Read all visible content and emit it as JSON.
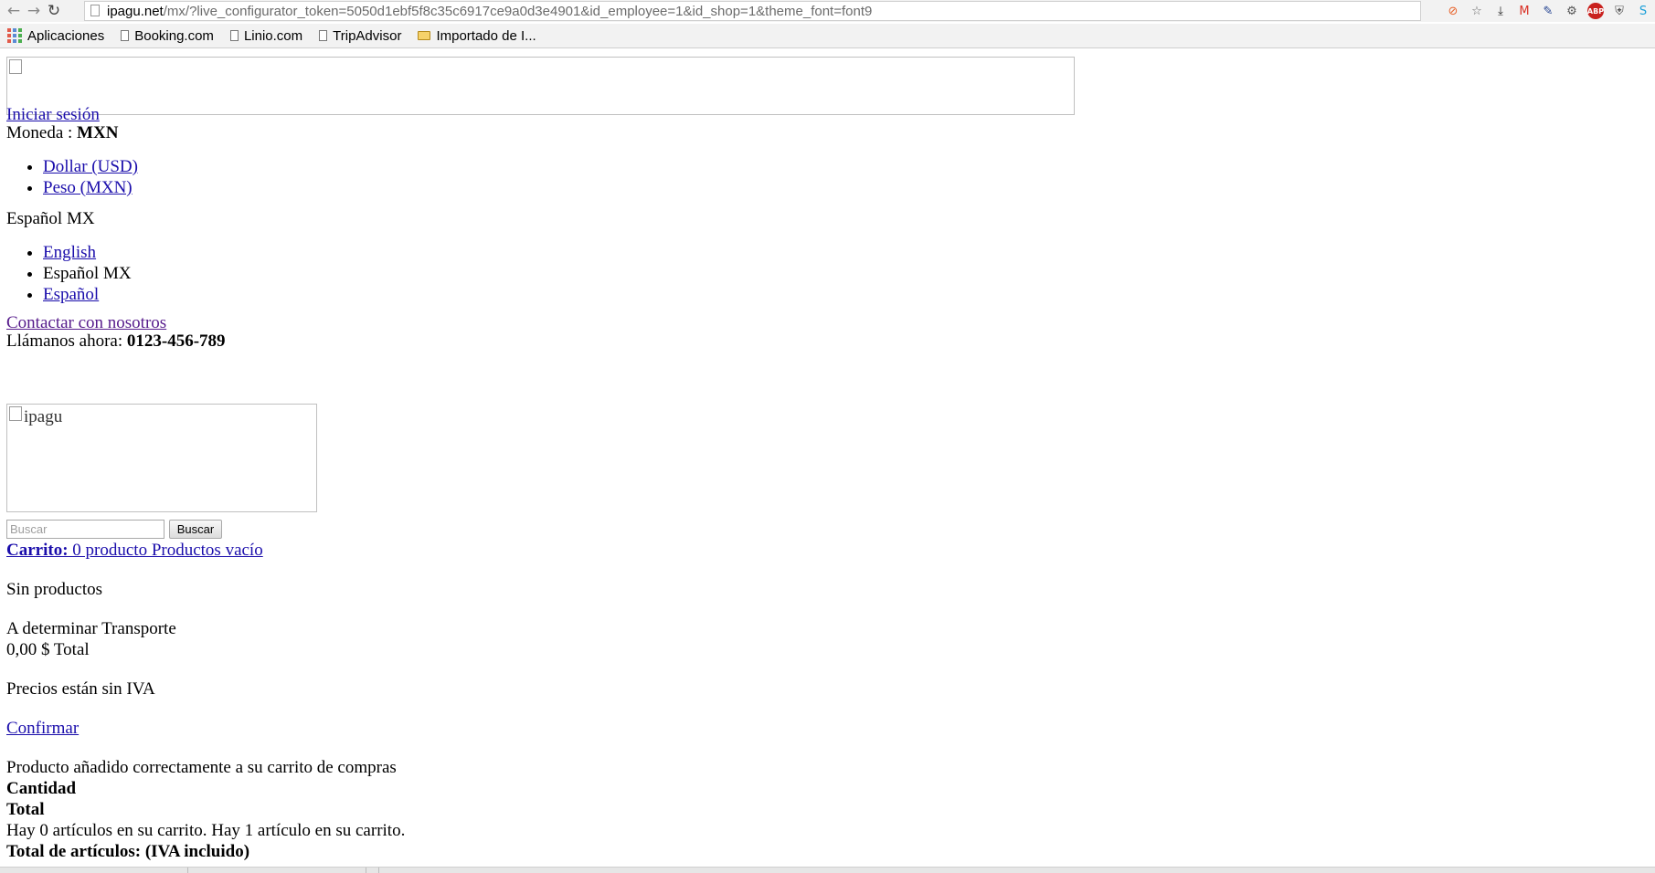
{
  "browser": {
    "nav": {
      "back": "←",
      "forward": "→",
      "reload": "↻"
    },
    "url_host": "ipagu.net",
    "url_rest": "/mx/?live_configurator_token=5050d1ebf5f8c35c6917ce9a0d3e4901&id_employee=1&id_shop=1&theme_font=font9",
    "extensions": [
      {
        "icon": "compass-icon",
        "glyph": "⊘",
        "color": "#e8632b"
      },
      {
        "icon": "star-icon",
        "glyph": "☆",
        "color": "#666666"
      },
      {
        "icon": "download-icon",
        "glyph": "⤓",
        "color": "#222222"
      },
      {
        "icon": "gmail-icon",
        "glyph": "M",
        "color": "#d93025"
      },
      {
        "icon": "pen-icon",
        "glyph": "✎",
        "color": "#1f3f8f"
      },
      {
        "icon": "puzzle-icon",
        "glyph": "⚙",
        "color": "#555555"
      },
      {
        "icon": "adblock-icon",
        "glyph": "ABP",
        "color": "#c9211e"
      },
      {
        "icon": "shield-icon",
        "glyph": "⛨",
        "color": "#555555"
      },
      {
        "icon": "skype-icon",
        "glyph": "S",
        "color": "#1a9fd8"
      }
    ],
    "bookmarks": [
      {
        "label": "Aplicaciones",
        "icon": "apps-icon"
      },
      {
        "label": "Booking.com",
        "icon": "page-icon"
      },
      {
        "label": "Linio.com",
        "icon": "page-icon"
      },
      {
        "label": "TripAdvisor",
        "icon": "page-icon"
      },
      {
        "label": "Importado de I...",
        "icon": "folder-icon"
      }
    ]
  },
  "header": {
    "login_link": "Iniciar sesión",
    "currency_label": "Moneda : ",
    "currency_value": "MXN",
    "currencies": [
      "Dollar (USD)",
      "Peso (MXN)"
    ],
    "language_current": "Español MX",
    "languages": [
      {
        "label": "English",
        "link": true
      },
      {
        "label": "Español MX",
        "link": false
      },
      {
        "label": "Español",
        "link": true
      }
    ],
    "contact_link": "Contactar con nosotros",
    "call_label": "Llámanos ahora: ",
    "phone": "0123-456-789",
    "logo_alt": "ipagu"
  },
  "search": {
    "placeholder": "Buscar",
    "button": "Buscar"
  },
  "cart": {
    "label_strong": "Carrito:",
    "summary": " 0 producto Productos vacío",
    "no_products": "Sin productos",
    "shipping": "A determinar Transporte",
    "total": "0,00 $ Total",
    "tax_note": "Precios están sin IVA",
    "confirm_link": "Confirmar"
  },
  "layer_cart": {
    "added_message": "Producto añadido correctamente a su carrito de compras",
    "quantity_label": "Cantidad",
    "total_label": "Total",
    "items_message": "Hay 0 artículos en su carrito. Hay 1 artículo en su carrito.",
    "total_items": "Total de artículos: (IVA incluido)"
  }
}
